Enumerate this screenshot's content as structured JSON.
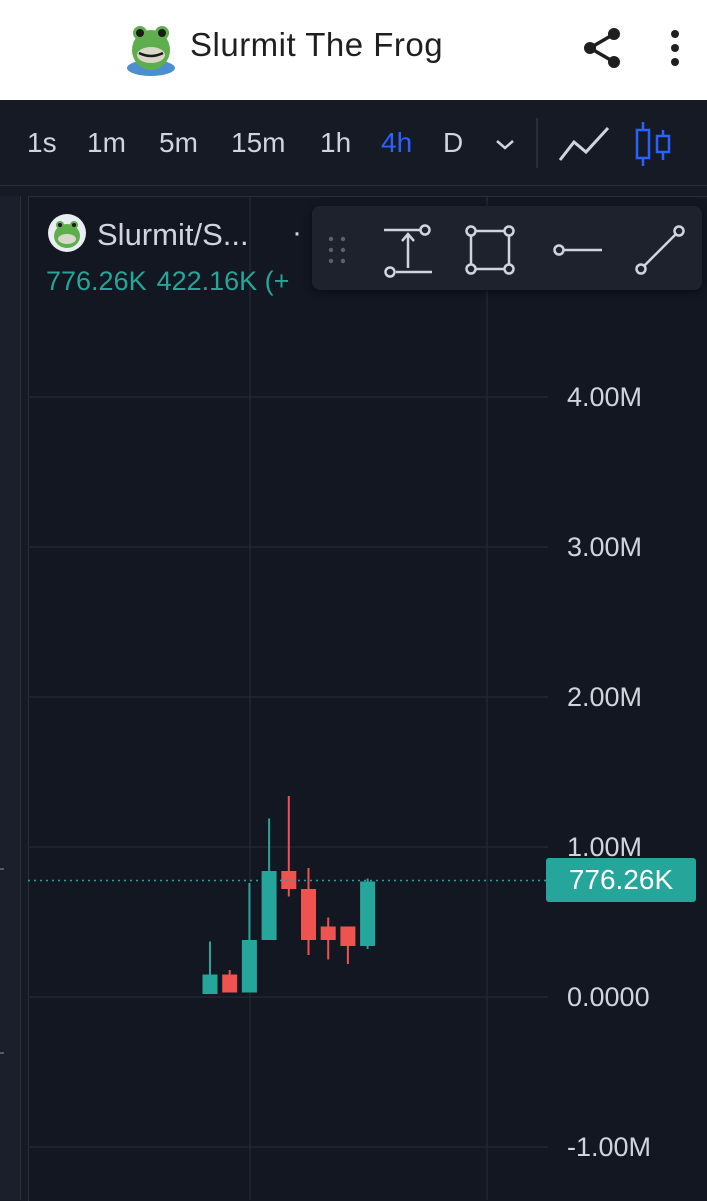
{
  "header": {
    "title": "Slurmit The Frog",
    "logo_icon": "frog-logo-icon",
    "share_icon": "share-icon",
    "more_icon": "more-vertical-icon"
  },
  "timeframes": {
    "items": [
      "1s",
      "1m",
      "5m",
      "15m",
      "1h",
      "4h",
      "D"
    ],
    "active": "4h",
    "dropdown_icon": "chevron-down-icon",
    "chart_type_icons": [
      "line-chart-icon",
      "candlestick-chart-icon"
    ]
  },
  "legend": {
    "symbol": "Slurmit/S...",
    "separator": "·",
    "price": "776.26K",
    "change": "422.16K (+"
  },
  "drawing_tools": [
    "drag-handle-icon",
    "price-range-icon",
    "rectangle-icon",
    "horizontal-ray-icon",
    "trend-line-icon"
  ],
  "price_axis": {
    "labels": [
      "4.00M",
      "3.00M",
      "2.00M",
      "1.00M",
      "0.0000",
      "-1.00M"
    ],
    "current_price": "776.26K"
  },
  "colors": {
    "up": "#26a69a",
    "down": "#ef5350",
    "accent": "#2962ff",
    "background": "#131722"
  },
  "chart_data": {
    "type": "candlestick",
    "ylim": [
      -1000000,
      4000000
    ],
    "current_price": 776260,
    "candles": [
      {
        "open": 20000,
        "high": 370000,
        "low": 20000,
        "close": 150000
      },
      {
        "open": 150000,
        "high": 180000,
        "low": 30000,
        "close": 30000
      },
      {
        "open": 30000,
        "high": 760000,
        "low": 30000,
        "close": 380000
      },
      {
        "open": 380000,
        "high": 1190000,
        "low": 380000,
        "close": 840000
      },
      {
        "open": 840000,
        "high": 1340000,
        "low": 670000,
        "close": 720000
      },
      {
        "open": 720000,
        "high": 860000,
        "low": 280000,
        "close": 380000
      },
      {
        "open": 470000,
        "high": 530000,
        "low": 250000,
        "close": 380000
      },
      {
        "open": 470000,
        "high": 470000,
        "low": 220000,
        "close": 340000
      },
      {
        "open": 340000,
        "high": 790000,
        "low": 320000,
        "close": 770000
      }
    ]
  }
}
